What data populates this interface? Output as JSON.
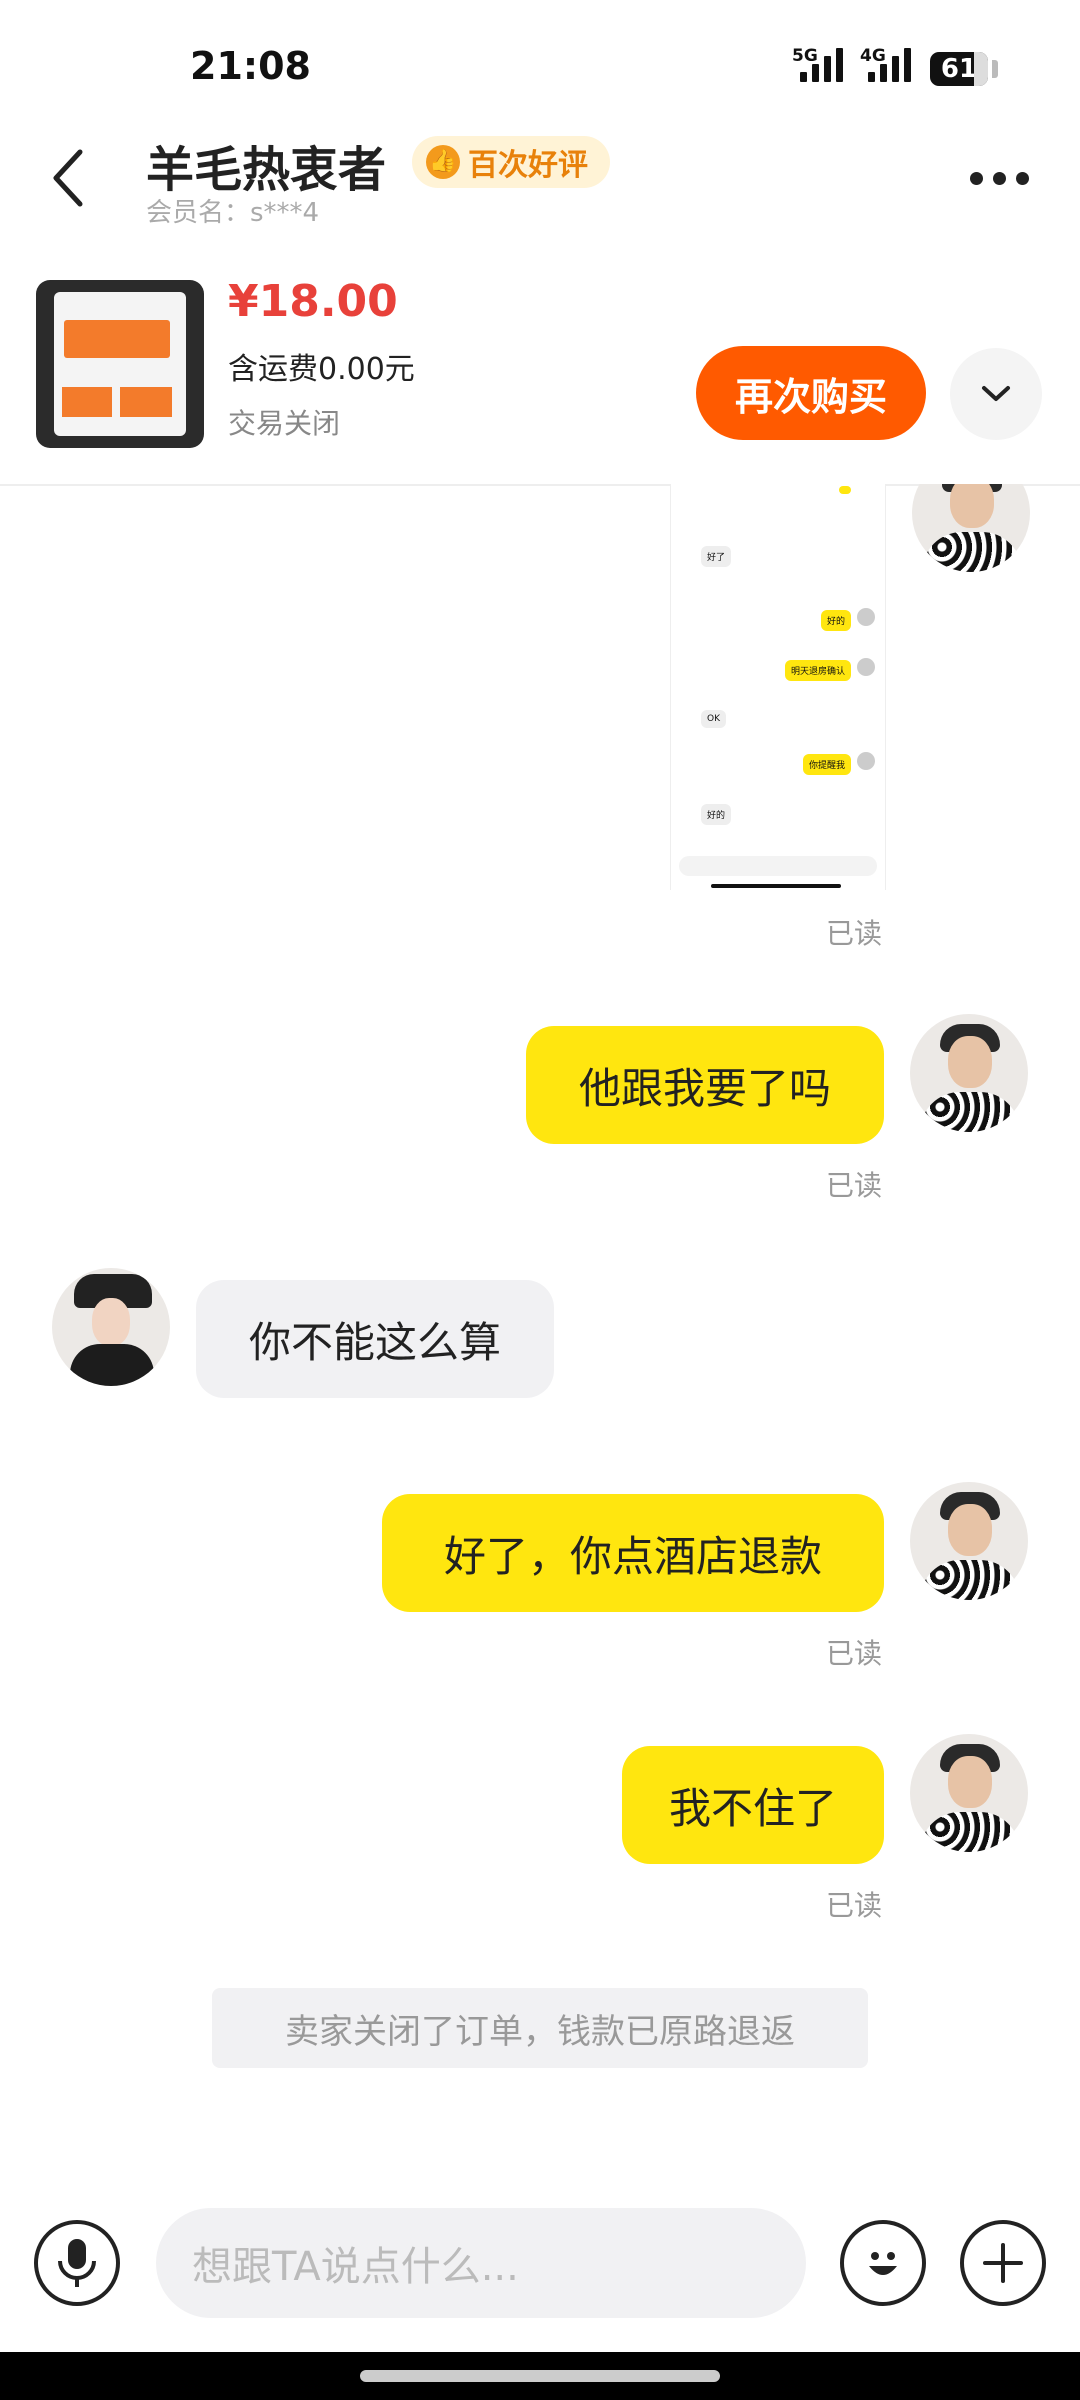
{
  "status": {
    "time": "21:08",
    "net1": "5G",
    "net2": "4G",
    "battery": "61"
  },
  "header": {
    "title": "羊毛热衷者",
    "badge": "百次好评",
    "member": "会员名：s***4"
  },
  "product": {
    "price": "¥18.00",
    "shipping": "含运费0.00元",
    "status": "交易关闭",
    "buy_again": "再次购买"
  },
  "screenshot_msgs": {
    "a": "好了",
    "b": "好的",
    "c": "明天退房确认",
    "d": "OK",
    "e": "你提醒我",
    "f": "好的",
    "input": "想跟TA说点什么..."
  },
  "messages": [
    {
      "from": "me",
      "text": "他跟我要了吗",
      "read": "已读"
    },
    {
      "from": "them",
      "text": "你不能这么算"
    },
    {
      "from": "me",
      "text": "好了，你点酒店退款",
      "read": "已读"
    },
    {
      "from": "me",
      "text": "我不住了",
      "read": "已读"
    }
  ],
  "first_read": "已读",
  "system_notice": "卖家关闭了订单，钱款已原路退返",
  "input": {
    "placeholder": "想跟TA说点什么..."
  }
}
